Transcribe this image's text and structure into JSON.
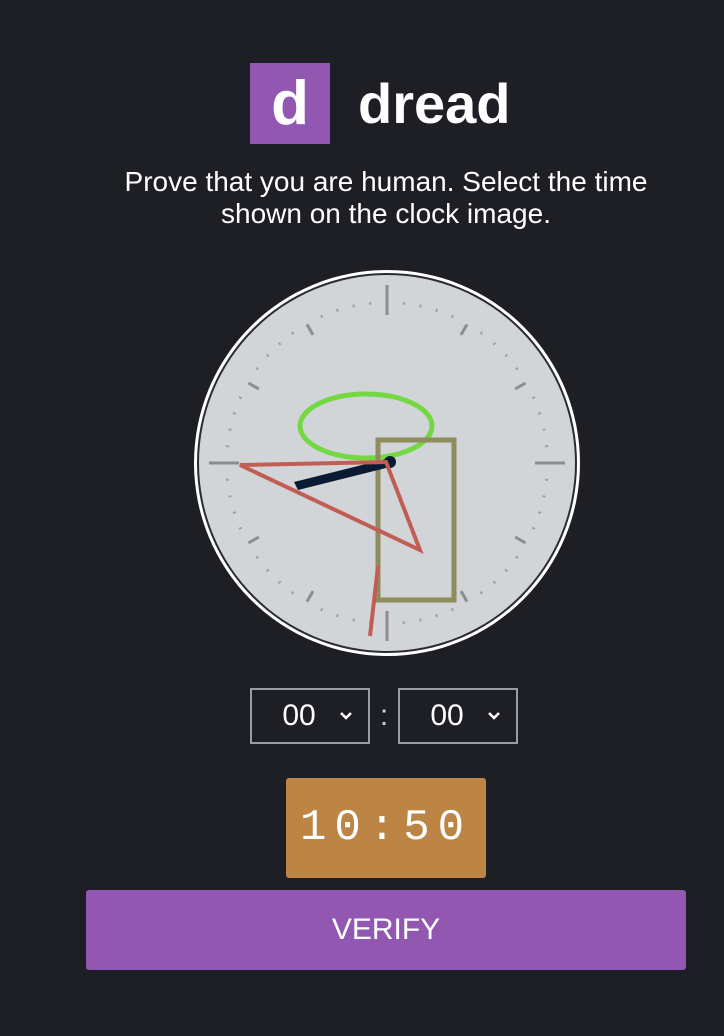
{
  "brand": {
    "logo_letter": "d",
    "name": "dread",
    "color": "#9257b0"
  },
  "instructions": {
    "line1": "Prove that you are human. Select the time",
    "line2": "shown on the clock image."
  },
  "clock": {
    "face_color": "#d1d5d8",
    "hour_hand_color": "#0a1a33",
    "distractor_ellipse_color": "#74d843",
    "distractor_rect_color": "#8f8c5c",
    "distractor_triangle_color": "#c25d56"
  },
  "time_select": {
    "hour_value": "00",
    "minute_value": "00",
    "separator": ":"
  },
  "time_display": {
    "text": "10:50",
    "color": "#bd8545"
  },
  "verify_button": {
    "label": "VERIFY"
  }
}
